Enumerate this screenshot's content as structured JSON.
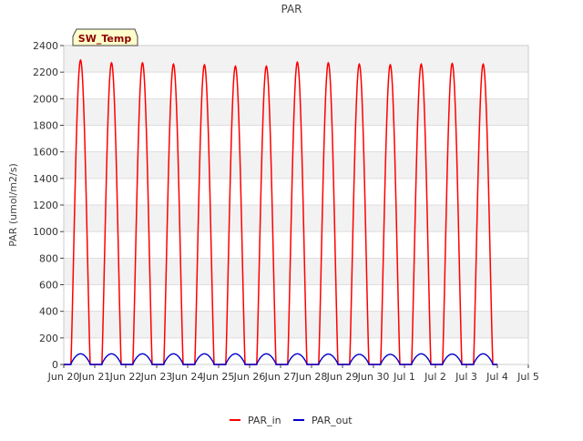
{
  "chart_data": {
    "type": "line",
    "title": "PAR",
    "ylabel": "PAR (umol/m2/s)",
    "xlabel": "",
    "ylim": [
      0,
      2400
    ],
    "xlim": [
      "2024-06-20",
      "2024-07-05"
    ],
    "y_ticks": [
      0,
      200,
      400,
      600,
      800,
      1000,
      1200,
      1400,
      1600,
      1800,
      2000,
      2200,
      2400
    ],
    "x_tick_labels": [
      "Jun 20",
      "Jun 21",
      "Jun 22",
      "Jun 23",
      "Jun 24",
      "Jun 25",
      "Jun 26",
      "Jun 27",
      "Jun 28",
      "Jun 29",
      "Jun 30",
      "Jul 1",
      "Jul 2",
      "Jul 3",
      "Jul 4",
      "Jul 5"
    ],
    "grid": true,
    "banded_background": true,
    "annotation": "SW_Temp",
    "legend_position": "bottom-center",
    "series": [
      {
        "name": "PAR_in",
        "color": "#ff0000",
        "daily_peaks": [
          {
            "date": "2024-06-20",
            "peak": 2290
          },
          {
            "date": "2024-06-21",
            "peak": 2270
          },
          {
            "date": "2024-06-22",
            "peak": 2270
          },
          {
            "date": "2024-06-23",
            "peak": 2260
          },
          {
            "date": "2024-06-24",
            "peak": 2255
          },
          {
            "date": "2024-06-25",
            "peak": 2245
          },
          {
            "date": "2024-06-26",
            "peak": 2245
          },
          {
            "date": "2024-06-27",
            "peak": 2275
          },
          {
            "date": "2024-06-28",
            "peak": 2270
          },
          {
            "date": "2024-06-29",
            "peak": 2260
          },
          {
            "date": "2024-06-30",
            "peak": 2255
          },
          {
            "date": "2024-07-01",
            "peak": 2260
          },
          {
            "date": "2024-07-02",
            "peak": 2265
          },
          {
            "date": "2024-07-03",
            "peak": 2260
          }
        ]
      },
      {
        "name": "PAR_out",
        "color": "#0000cc",
        "daily_peaks": [
          {
            "date": "2024-06-20",
            "peak": 80
          },
          {
            "date": "2024-06-21",
            "peak": 80
          },
          {
            "date": "2024-06-22",
            "peak": 80
          },
          {
            "date": "2024-06-23",
            "peak": 80
          },
          {
            "date": "2024-06-24",
            "peak": 80
          },
          {
            "date": "2024-06-25",
            "peak": 80
          },
          {
            "date": "2024-06-26",
            "peak": 80
          },
          {
            "date": "2024-06-27",
            "peak": 80
          },
          {
            "date": "2024-06-28",
            "peak": 78
          },
          {
            "date": "2024-06-29",
            "peak": 76
          },
          {
            "date": "2024-06-30",
            "peak": 76
          },
          {
            "date": "2024-07-01",
            "peak": 80
          },
          {
            "date": "2024-07-02",
            "peak": 78
          },
          {
            "date": "2024-07-03",
            "peak": 80
          }
        ]
      }
    ]
  }
}
